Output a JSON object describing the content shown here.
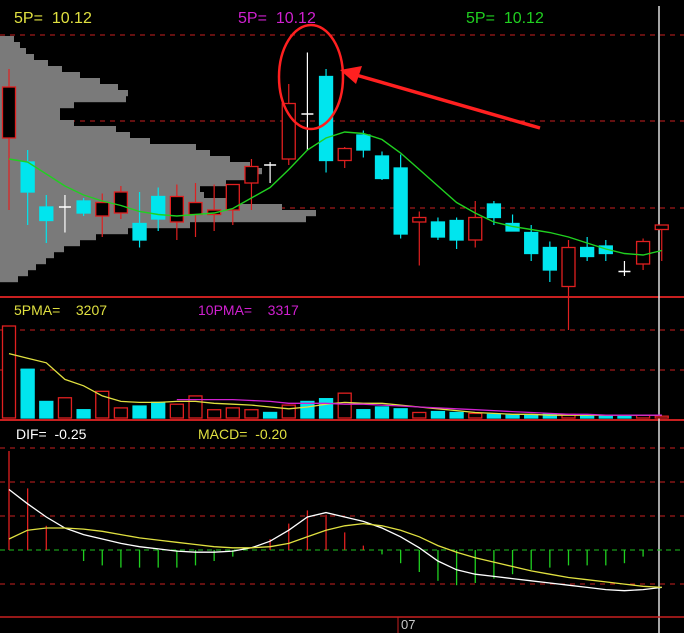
{
  "price_panel": {
    "labels": [
      {
        "name": "5P=",
        "value": "10.12",
        "color": "#e0e040"
      },
      {
        "name": "5P=",
        "value": "10.12",
        "color": "#d020d0"
      },
      {
        "name": "5P=",
        "value": "10.12",
        "color": "#20d020"
      }
    ]
  },
  "volume_panel": {
    "ma5_label": "5PMA=",
    "ma5_value": "3207",
    "ma10_label": "10PMA=",
    "ma10_value": "3317"
  },
  "macd_panel": {
    "dif_label": "DIF=",
    "dif_value": "-0.25",
    "macd_label": "MACD=",
    "macd_value": "-0.20"
  },
  "time_axis": {
    "tick": "07"
  },
  "colors": {
    "up": "#e02020",
    "down": "#00e5ee",
    "ma5": "#20d020",
    "vol_ma5": "#e0e040",
    "vol_ma10": "#d020d0",
    "dif": "#ffffff",
    "dea": "#e0e040",
    "grid": "#c82020",
    "profile": "#7a7a7a",
    "annotation": "#ff2020"
  },
  "chart_data": [
    {
      "type": "candlestick",
      "candles": [
        {
          "o": 88,
          "h": 134,
          "l": 40,
          "c": 122
        },
        {
          "o": 72,
          "h": 80,
          "l": 30,
          "c": 52
        },
        {
          "o": 42,
          "h": 50,
          "l": 18,
          "c": 33
        },
        {
          "o": 41,
          "h": 50,
          "l": 25,
          "c": 42
        },
        {
          "o": 46,
          "h": 48,
          "l": 36,
          "c": 38
        },
        {
          "o": 36,
          "h": 51,
          "l": 22,
          "c": 45
        },
        {
          "o": 38,
          "h": 56,
          "l": 34,
          "c": 52
        },
        {
          "o": 31,
          "h": 52,
          "l": 15,
          "c": 20
        },
        {
          "o": 49,
          "h": 55,
          "l": 26,
          "c": 34
        },
        {
          "o": 32,
          "h": 57,
          "l": 20,
          "c": 49
        },
        {
          "o": 37,
          "h": 58,
          "l": 22,
          "c": 45
        },
        {
          "o": 37,
          "h": 57,
          "l": 26,
          "c": 40
        },
        {
          "o": 40,
          "h": 55,
          "l": 30,
          "c": 57
        },
        {
          "o": 58,
          "h": 74,
          "l": 40,
          "c": 69
        },
        {
          "o": 70,
          "h": 72,
          "l": 58,
          "c": 70
        },
        {
          "o": 74,
          "h": 124,
          "l": 70,
          "c": 111
        },
        {
          "o": 105,
          "h": 145,
          "l": 80,
          "c": 104
        },
        {
          "o": 129,
          "h": 134,
          "l": 65,
          "c": 73
        },
        {
          "o": 73,
          "h": 82,
          "l": 68,
          "c": 81
        },
        {
          "o": 90,
          "h": 93,
          "l": 75,
          "c": 80
        },
        {
          "o": 76,
          "h": 79,
          "l": 60,
          "c": 61
        },
        {
          "o": 68,
          "h": 77,
          "l": 21,
          "c": 24
        },
        {
          "o": 32,
          "h": 39,
          "l": 3,
          "c": 35
        },
        {
          "o": 32,
          "h": 35,
          "l": 20,
          "c": 22
        },
        {
          "o": 33,
          "h": 35,
          "l": 14,
          "c": 20
        },
        {
          "o": 20,
          "h": 46,
          "l": 15,
          "c": 35
        },
        {
          "o": 44,
          "h": 46,
          "l": 30,
          "c": 35
        },
        {
          "o": 31,
          "h": 37,
          "l": 26,
          "c": 26
        },
        {
          "o": 25,
          "h": 30,
          "l": 6,
          "c": 11
        },
        {
          "o": 15,
          "h": 19,
          "l": -8,
          "c": 0
        },
        {
          "o": -11,
          "h": 20,
          "l": -40,
          "c": 15
        },
        {
          "o": 15,
          "h": 22,
          "l": 6,
          "c": 9
        },
        {
          "o": 16,
          "h": 20,
          "l": 6,
          "c": 11
        },
        {
          "o": -1,
          "h": 6,
          "l": -4,
          "c": -1
        },
        {
          "o": 4,
          "h": 21,
          "l": 0,
          "c": 19
        },
        {
          "o": 27,
          "h": 30,
          "l": 6,
          "c": 30
        }
      ],
      "ma5": [
        74,
        72,
        64,
        56,
        50,
        46,
        43,
        39,
        37,
        36,
        37,
        38,
        41,
        48,
        55,
        67,
        80,
        88,
        92,
        91,
        87,
        78,
        67,
        56,
        45,
        38,
        32,
        29,
        27,
        25,
        22,
        18,
        14,
        11,
        10,
        13
      ],
      "profile": [
        {
          "price": 154,
          "len": 14
        },
        {
          "price": 150,
          "len": 20
        },
        {
          "price": 146,
          "len": 26
        },
        {
          "price": 142,
          "len": 34
        },
        {
          "price": 138,
          "len": 48
        },
        {
          "price": 134,
          "len": 62
        },
        {
          "price": 130,
          "len": 80
        },
        {
          "price": 126,
          "len": 100
        },
        {
          "price": 122,
          "len": 118
        },
        {
          "price": 118,
          "len": 128
        },
        {
          "price": 114,
          "len": 126
        },
        {
          "price": 110,
          "len": 74
        },
        {
          "price": 106,
          "len": 60
        },
        {
          "price": 102,
          "len": 60
        },
        {
          "price": 98,
          "len": 74
        },
        {
          "price": 94,
          "len": 116
        },
        {
          "price": 90,
          "len": 130
        },
        {
          "price": 86,
          "len": 150
        },
        {
          "price": 82,
          "len": 196
        },
        {
          "price": 78,
          "len": 210
        },
        {
          "price": 74,
          "len": 230
        },
        {
          "price": 70,
          "len": 250
        },
        {
          "price": 66,
          "len": 262
        },
        {
          "price": 62,
          "len": 246
        },
        {
          "price": 58,
          "len": 226
        },
        {
          "price": 54,
          "len": 200
        },
        {
          "price": 50,
          "len": 204
        },
        {
          "price": 46,
          "len": 236
        },
        {
          "price": 42,
          "len": 282
        },
        {
          "price": 38,
          "len": 316
        },
        {
          "price": 34,
          "len": 306
        },
        {
          "price": 30,
          "len": 190
        },
        {
          "price": 26,
          "len": 128
        },
        {
          "price": 22,
          "len": 96
        },
        {
          "price": 18,
          "len": 80
        },
        {
          "price": 14,
          "len": 64
        },
        {
          "price": 10,
          "len": 54
        },
        {
          "price": 6,
          "len": 46
        },
        {
          "price": 2,
          "len": 36
        },
        {
          "price": -2,
          "len": 28
        },
        {
          "price": -6,
          "len": 18
        }
      ]
    },
    {
      "type": "bar",
      "volume": [
        100,
        53,
        18,
        22,
        9,
        29,
        11,
        13,
        17,
        15,
        24,
        9,
        11,
        9,
        6,
        14,
        18,
        21,
        27,
        9,
        12,
        10,
        6,
        7,
        6,
        5,
        4,
        3,
        3,
        4,
        4,
        3,
        3,
        2,
        3,
        2
      ],
      "vol_ma5": [
        70,
        65,
        60,
        42,
        35,
        24,
        18,
        17,
        17,
        18,
        18,
        16,
        15,
        14,
        12,
        10,
        12,
        15,
        17,
        16,
        16,
        14,
        12,
        10,
        8,
        6,
        5,
        4,
        4,
        3,
        3,
        3,
        3,
        3,
        3,
        3
      ],
      "vol_ma10": [
        0,
        0,
        0,
        0,
        0,
        0,
        0,
        0,
        0,
        20,
        20,
        20,
        20,
        19,
        18,
        16,
        16,
        16,
        15,
        15,
        14,
        13,
        12,
        11,
        10,
        9,
        8,
        7,
        6,
        5,
        4,
        4,
        3,
        3,
        3,
        3
      ]
    },
    {
      "type": "line",
      "dif": [
        0.55,
        0.42,
        0.3,
        0.2,
        0.14,
        0.1,
        0.06,
        0.03,
        0.01,
        -0.01,
        -0.02,
        -0.02,
        -0.01,
        0.02,
        0.08,
        0.18,
        0.3,
        0.34,
        0.3,
        0.26,
        0.2,
        0.12,
        0.02,
        -0.1,
        -0.18,
        -0.22,
        -0.24,
        -0.26,
        -0.28,
        -0.3,
        -0.32,
        -0.34,
        -0.36,
        -0.37,
        -0.36,
        -0.34
      ],
      "dea": [
        0.1,
        0.18,
        0.2,
        0.2,
        0.19,
        0.17,
        0.14,
        0.11,
        0.09,
        0.07,
        0.05,
        0.03,
        0.02,
        0.02,
        0.03,
        0.06,
        0.12,
        0.18,
        0.22,
        0.24,
        0.22,
        0.18,
        0.12,
        0.04,
        -0.02,
        -0.07,
        -0.11,
        -0.15,
        -0.19,
        -0.22,
        -0.25,
        -0.27,
        -0.29,
        -0.31,
        -0.33,
        -0.34
      ],
      "macd": [
        0.9,
        0.56,
        0.22,
        0.0,
        -0.1,
        -0.14,
        -0.16,
        -0.16,
        -0.16,
        -0.16,
        -0.14,
        -0.1,
        -0.06,
        0.0,
        0.1,
        0.24,
        0.36,
        0.32,
        0.16,
        0.04,
        -0.04,
        -0.12,
        -0.2,
        -0.28,
        -0.32,
        -0.3,
        -0.26,
        -0.22,
        -0.18,
        -0.16,
        -0.14,
        -0.14,
        -0.14,
        -0.12,
        -0.06,
        0.0
      ]
    }
  ]
}
